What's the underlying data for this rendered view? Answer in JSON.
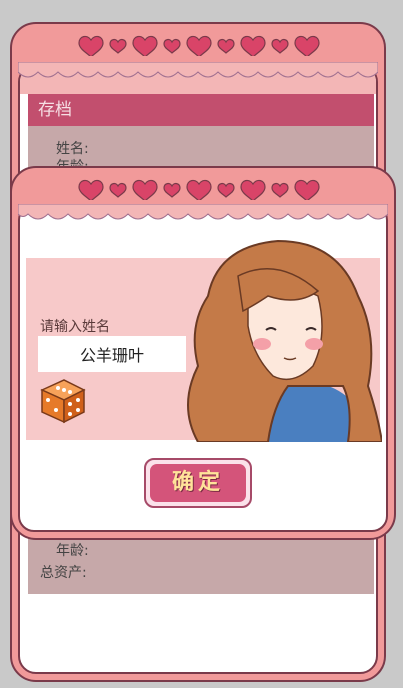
{
  "save_panel": {
    "title": "存档",
    "name_label": "姓名:",
    "age_label_partial": "年龄:",
    "age_label": "年龄:",
    "assets_label": "总资产:"
  },
  "dialog": {
    "prompt": "请输入姓名",
    "name_value": "公羊珊叶",
    "confirm_label": "确定"
  },
  "colors": {
    "frame_pink": "#f19a9a",
    "border": "#7a3a4a",
    "header": "#c24f6e",
    "button": "#d4547a",
    "button_text": "#ffe39a",
    "heart": "#d94468"
  }
}
